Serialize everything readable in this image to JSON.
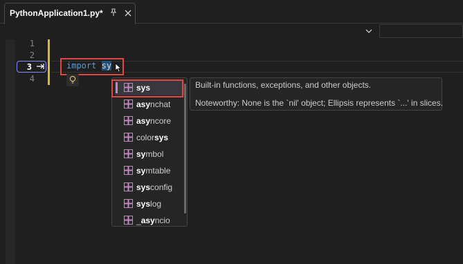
{
  "tab": {
    "title": "PythonApplication1.py*"
  },
  "editor": {
    "line_numbers": [
      "1",
      "2",
      "3",
      "4"
    ],
    "code": {
      "keyword": "import",
      "typed": "sy"
    }
  },
  "completion": {
    "items": [
      {
        "match": "sys",
        "rest": ""
      },
      {
        "match": "asy",
        "rest": "nchat"
      },
      {
        "match": "asy",
        "rest": "ncore"
      },
      {
        "prefix": "color",
        "match": "sys",
        "rest": ""
      },
      {
        "match": "sy",
        "rest": "mbol"
      },
      {
        "match": "sy",
        "rest": "mtable"
      },
      {
        "match": "sys",
        "rest": "config"
      },
      {
        "match": "sys",
        "rest": "log"
      },
      {
        "prefix": "_",
        "match": "asy",
        "rest": "ncio"
      }
    ]
  },
  "tooltip": {
    "line1": "Built-in functions, exceptions, and other objects.",
    "line2": "Noteworthy: None is the `nil' object; Ellipsis represents `...' in slices."
  },
  "colors": {
    "accent": "#c586c0",
    "highlight": "#e34545",
    "change_bar": "#d7ba36",
    "keyword": "#569cd6"
  }
}
